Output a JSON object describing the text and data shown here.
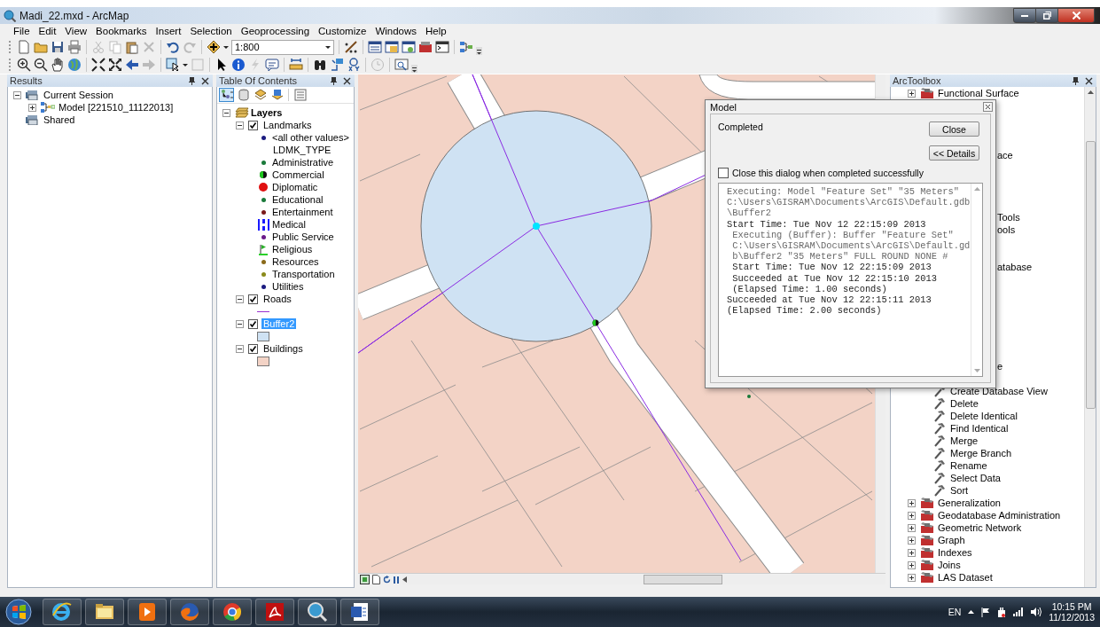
{
  "window": {
    "title": "Madi_22.mxd - ArcMap"
  },
  "menu": [
    "File",
    "Edit",
    "View",
    "Bookmarks",
    "Insert",
    "Selection",
    "Geoprocessing",
    "Customize",
    "Windows",
    "Help"
  ],
  "toolbar": {
    "scale": "1:800"
  },
  "results": {
    "title": "Results",
    "items": [
      {
        "label": "Current Session",
        "expanded": true,
        "children": [
          {
            "label": "Model [221510_11122013]",
            "expanded": false
          }
        ]
      },
      {
        "label": "Shared"
      }
    ]
  },
  "toc": {
    "title": "Table Of Contents",
    "view_modes": [
      {
        "selected": true
      },
      {
        "selected": false
      },
      {
        "selected": false
      },
      {
        "selected": false
      },
      {
        "selected": false
      }
    ],
    "root": {
      "label": "Layers",
      "expanded": true
    },
    "layers": [
      {
        "name": "Landmarks",
        "expanded": true,
        "checked": true,
        "selected": false,
        "legend": [
          {
            "kind": "dot",
            "label": "<all other values>",
            "color": "#1b1b80"
          },
          {
            "kind": "heading",
            "label": "LDMK_TYPE"
          },
          {
            "kind": "dot",
            "label": "Administrative",
            "color": "#1a7a3a"
          },
          {
            "kind": "split-dot",
            "label": "Commercial"
          },
          {
            "kind": "large-dot",
            "label": "Diplomatic",
            "color": "#e01010"
          },
          {
            "kind": "dot",
            "label": "Educational",
            "color": "#1a7a3a"
          },
          {
            "kind": "dot",
            "label": "Entertainment",
            "color": "#7a1a1a"
          },
          {
            "kind": "hospital",
            "label": "Medical"
          },
          {
            "kind": "dot",
            "label": "Public Service",
            "color": "#6a1a8a"
          },
          {
            "kind": "flag",
            "label": "Religious"
          },
          {
            "kind": "dot",
            "label": "Resources",
            "color": "#8a6a1a"
          },
          {
            "kind": "dot",
            "label": "Transportation",
            "color": "#8a8a1a"
          },
          {
            "kind": "dot",
            "label": "Utilities",
            "color": "#1b1b80"
          }
        ]
      },
      {
        "name": "Roads",
        "expanded": true,
        "checked": true,
        "selected": false,
        "legend": [
          {
            "kind": "line",
            "color": "#9b30d0"
          }
        ]
      },
      {
        "name": "Buffer2",
        "expanded": true,
        "checked": true,
        "selected": true,
        "legend": [
          {
            "kind": "fill",
            "color": "#cfe2f3"
          }
        ]
      },
      {
        "name": "Buildings",
        "expanded": true,
        "checked": true,
        "selected": false,
        "legend": [
          {
            "kind": "fill",
            "color": "#f3d3c6"
          }
        ]
      }
    ]
  },
  "toolbox": {
    "title": "ArcToolbox",
    "items": [
      {
        "kind": "toolset",
        "label": "Functional Surface",
        "expanded": false
      },
      {
        "kind": "fragment",
        "label": "ace"
      },
      {
        "kind": "fragment",
        "label": "Tools"
      },
      {
        "kind": "fragment",
        "label": "ools"
      },
      {
        "kind": "fragment",
        "label": "atabase"
      },
      {
        "kind": "fragment",
        "label": "e"
      },
      {
        "kind": "tool",
        "label": "Create Database View"
      },
      {
        "kind": "tool",
        "label": "Delete"
      },
      {
        "kind": "tool",
        "label": "Delete Identical"
      },
      {
        "kind": "tool",
        "label": "Find Identical"
      },
      {
        "kind": "tool",
        "label": "Merge"
      },
      {
        "kind": "tool",
        "label": "Merge Branch"
      },
      {
        "kind": "tool",
        "label": "Rename"
      },
      {
        "kind": "tool",
        "label": "Select Data"
      },
      {
        "kind": "tool",
        "label": "Sort"
      },
      {
        "kind": "toolset",
        "label": "Generalization",
        "expanded": false
      },
      {
        "kind": "toolset",
        "label": "Geodatabase Administration",
        "expanded": false
      },
      {
        "kind": "toolset",
        "label": "Geometric Network",
        "expanded": false
      },
      {
        "kind": "toolset",
        "label": "Graph",
        "expanded": false
      },
      {
        "kind": "toolset",
        "label": "Indexes",
        "expanded": false
      },
      {
        "kind": "toolset",
        "label": "Joins",
        "expanded": false
      },
      {
        "kind": "toolset",
        "label": "LAS Dataset",
        "expanded": false
      }
    ]
  },
  "dialog": {
    "title": "Model",
    "status": "Completed",
    "buttons": [
      "Close",
      "<< Details"
    ],
    "close_when_done": {
      "label": "Close this dialog when completed successfully",
      "checked": false
    },
    "messages": [
      {
        "kind": "command",
        "text": "Executing: Model \"Feature Set\" \"35 Meters\" C:\\Users\\GISRAM\\Documents\\ArcGIS\\Default.gdb\\Buffer2"
      },
      {
        "kind": "status",
        "text": "Start Time: Tue Nov 12 22:15:09 2013",
        "children": [
          {
            "kind": "command",
            "text": "Executing (Buffer): Buffer \"Feature Set\" C:\\Users\\GISRAM\\Documents\\ArcGIS\\Default.gdb\\Buffer2 \"35 Meters\" FULL ROUND NONE #"
          },
          {
            "kind": "status",
            "text": "Start Time: Tue Nov 12 22:15:09 2013"
          },
          {
            "kind": "status",
            "text": "Succeeded at Tue Nov 12 22:15:10 2013"
          },
          {
            "kind": "status",
            "text": "(Elapsed Time: 1.00 seconds)"
          }
        ]
      },
      {
        "kind": "status",
        "text": "Succeeded at Tue Nov 12 22:15:11 2013"
      },
      {
        "kind": "status",
        "text": "(Elapsed Time: 2.00 seconds)"
      }
    ]
  },
  "taskbar": {
    "language": "EN",
    "time": "10:15 PM",
    "date": "11/12/2013"
  }
}
